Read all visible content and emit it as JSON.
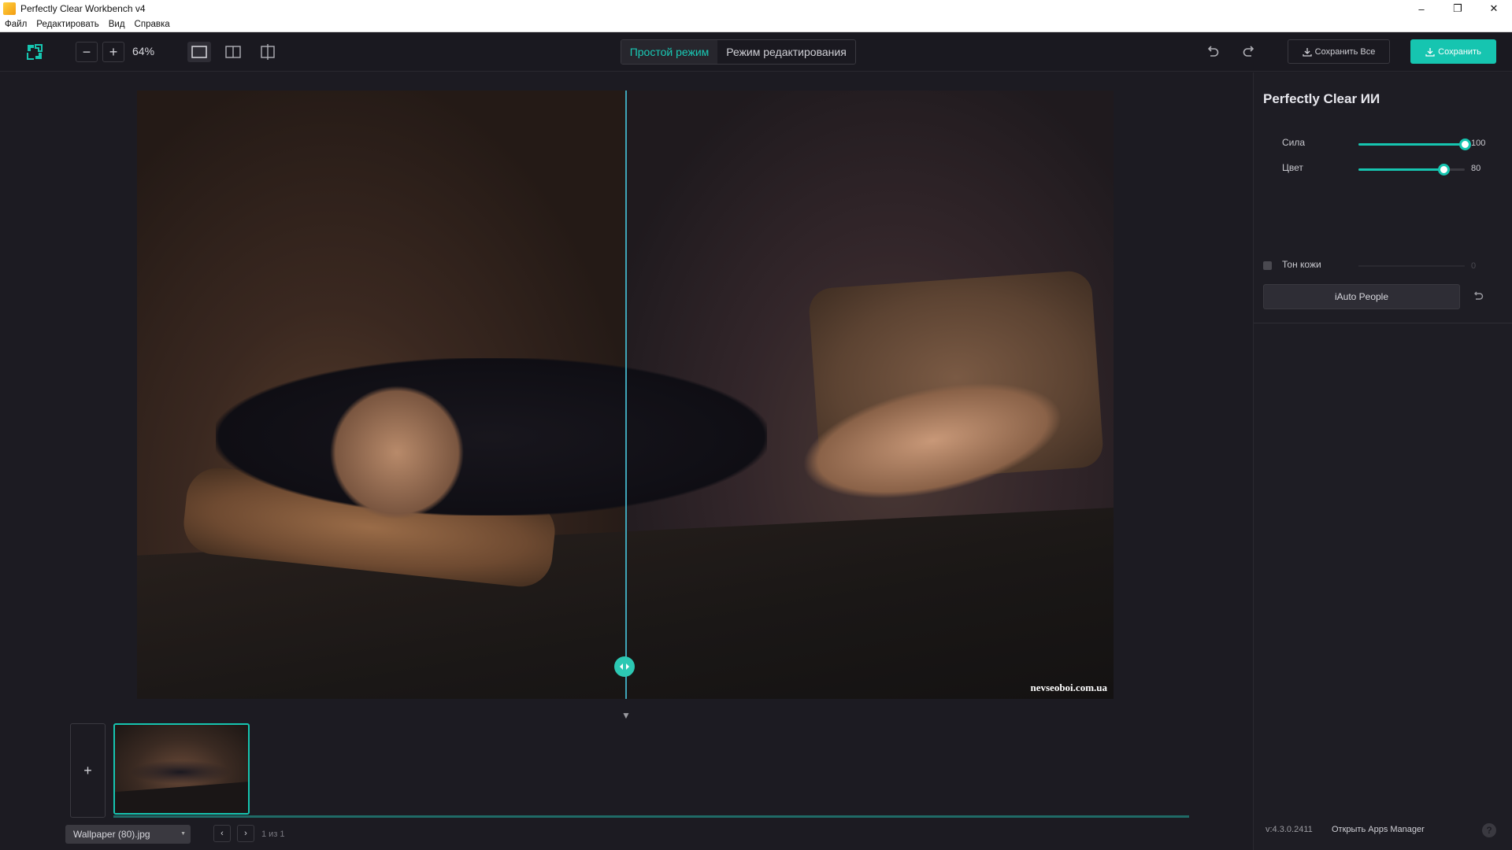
{
  "window": {
    "title": "Perfectly Clear Workbench v4",
    "minimize": "–",
    "maximize": "❐",
    "close": "✕"
  },
  "menu": {
    "items": [
      "Файл",
      "Редактировать",
      "Вид",
      "Справка"
    ]
  },
  "toolbar": {
    "zoom_out": "−",
    "zoom_in": "+",
    "zoom_level": "64%",
    "modes": {
      "simple": "Простой режим",
      "edit": "Режим редактирования"
    },
    "save_all_label": "Сохранить Все",
    "save_label": "Сохранить",
    "accent_color": "#16c5b0"
  },
  "canvas": {
    "watermark": "nevseoboi.com.ua",
    "split_position_fraction": 0.5,
    "collapse_icon": "▼"
  },
  "filmstrip": {
    "add_label": "+",
    "file_name": "Wallpaper (80).jpg",
    "prev": "‹",
    "next": "›",
    "page_count": "1 из 1"
  },
  "panel": {
    "title": "Perfectly Clear ИИ",
    "sliders": [
      {
        "label": "Сила",
        "value": "100",
        "fraction": 1.0
      },
      {
        "label": "Цвет",
        "value": "80",
        "fraction": 0.8
      }
    ],
    "skin_tone": {
      "label": "Тон кожи",
      "value": "0",
      "checked": false
    },
    "iauto_label": "iAuto People",
    "version": "v:4.3.0.2411",
    "apps_manager": "Открыть Apps Manager",
    "help": "?"
  }
}
